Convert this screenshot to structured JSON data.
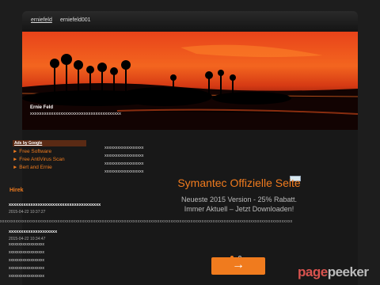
{
  "nav": {
    "tabs": [
      "erniefeld",
      "erniefeld001"
    ]
  },
  "site": {
    "title": "Ernie Feld",
    "tagline": "xxxxxxxxxxxxxxxxxxxxxxxxxxxxxxxxxxxxxxx"
  },
  "ads": {
    "heading": "Ads by Google",
    "links": [
      "► Free Software",
      "► Free AntiVirus Scan",
      "► Bert and Ernie"
    ]
  },
  "middle_column": [
    "xxxxxxxxxxxxxxxxxx",
    "xxxxxxxxxxxxxxxxxx",
    "xxxxxxxxxxxxxxxxxx",
    "xxxxxxxxxxxxxxxxxx"
  ],
  "news": {
    "heading": "Hirek",
    "items": [
      {
        "title": "xxxxxxxxxxxxxxxxxxxxxxxxxxxxxxxxxxxxxx",
        "date": "2015-04-22 10:37:27"
      },
      {
        "title": "xxxxxxxxxxxxxxxxxxxx",
        "date": "2015-04-22 10:34:47"
      }
    ],
    "sublist": [
      "xxxxxxxxxxxxxxxxxx",
      "xxxxxxxxxxxxxxxxxx",
      "xxxxxxxxxxxxxxxxxx",
      "xxxxxxxxxxxxxxxxxx",
      "xxxxxxxxxxxxxxxxxx"
    ]
  },
  "promo": {
    "title": "Symantec Offizielle Seite",
    "text": "Neueste 2015 Version - 25% Rabatt. Immer Aktuell – Jetzt Downloaden!",
    "button": "→"
  },
  "dotted_row": "xxxxxxxxxxxxxxxxxxxxxxxxxxxxxxxxxxxxxxxxxxxxxxxxxxxxxxxxxxxxxxxxxxxxxxxxxxxxxxxxxxxxxxxxxxxxxxxxxxxxxxxxxxxxxxxxxxxxxxxxxxxxxxxxxxxx",
  "watermark": {
    "part1": "page",
    "part2": "peeker"
  }
}
